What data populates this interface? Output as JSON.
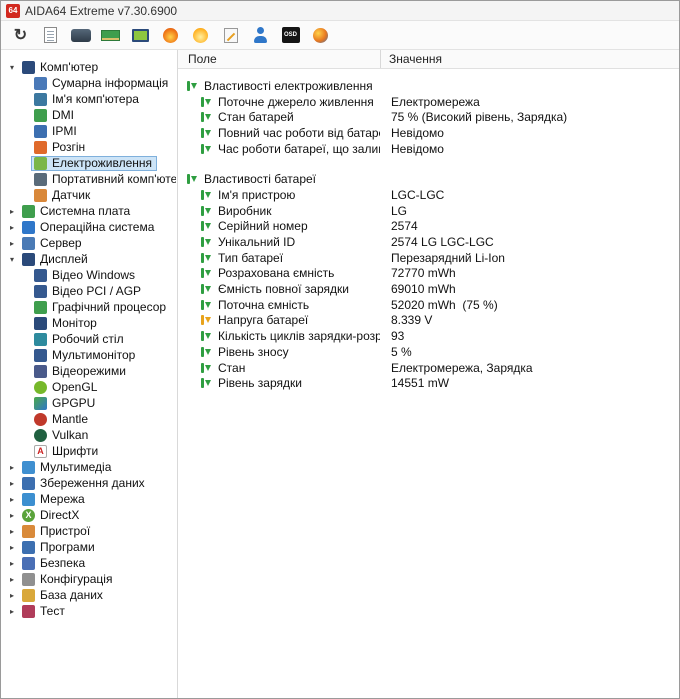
{
  "window": {
    "title": "AIDA64 Extreme v7.30.6900",
    "logo_text": "64"
  },
  "toolbar": {
    "buttons": [
      {
        "icon": "refresh-icon"
      },
      {
        "icon": "report-icon"
      },
      {
        "icon": "display-card-icon"
      },
      {
        "icon": "memory-icon"
      },
      {
        "icon": "monitor-test-icon"
      },
      {
        "icon": "burn-in-icon"
      },
      {
        "icon": "flame-icon"
      },
      {
        "icon": "notes-icon"
      },
      {
        "icon": "audit-icon"
      },
      {
        "icon": "osd-icon",
        "label": "OSD"
      },
      {
        "icon": "sensor-panel-icon"
      }
    ]
  },
  "sidebar": {
    "items": [
      {
        "label": "Комп'ютер",
        "level": 0,
        "icon": "computer",
        "expanded": true
      },
      {
        "label": "Сумарна інформація",
        "level": 1,
        "icon": "summary"
      },
      {
        "label": "Ім'я комп'ютера",
        "level": 1,
        "icon": "computer-name"
      },
      {
        "label": "DMI",
        "level": 1,
        "icon": "dmi"
      },
      {
        "label": "IPMI",
        "level": 1,
        "icon": "ipmi"
      },
      {
        "label": "Розгін",
        "level": 1,
        "icon": "overclock"
      },
      {
        "label": "Електроживлення",
        "level": 1,
        "icon": "power",
        "selected": true
      },
      {
        "label": "Портативний комп'ютер",
        "level": 1,
        "icon": "portable"
      },
      {
        "label": "Датчик",
        "level": 1,
        "icon": "sensor"
      },
      {
        "label": "Системна плата",
        "level": 0,
        "icon": "motherboard",
        "expanded": false
      },
      {
        "label": "Операційна система",
        "level": 0,
        "icon": "os",
        "expanded": false
      },
      {
        "label": "Сервер",
        "level": 0,
        "icon": "server",
        "expanded": false
      },
      {
        "label": "Дисплей",
        "level": 0,
        "icon": "display",
        "expanded": true
      },
      {
        "label": "Відео Windows",
        "level": 1,
        "icon": "video-windows"
      },
      {
        "label": "Відео PCI / AGP",
        "level": 1,
        "icon": "video-pci"
      },
      {
        "label": "Графічний процесор",
        "level": 1,
        "icon": "gpu"
      },
      {
        "label": "Монітор",
        "level": 1,
        "icon": "monitor"
      },
      {
        "label": "Робочий стіл",
        "level": 1,
        "icon": "desktop"
      },
      {
        "label": "Мультимонітор",
        "level": 1,
        "icon": "multimonitor"
      },
      {
        "label": "Відеорежими",
        "level": 1,
        "icon": "videomodes"
      },
      {
        "label": "OpenGL",
        "level": 1,
        "icon": "opengl"
      },
      {
        "label": "GPGPU",
        "level": 1,
        "icon": "gpgpu"
      },
      {
        "label": "Mantle",
        "level": 1,
        "icon": "mantle"
      },
      {
        "label": "Vulkan",
        "level": 1,
        "icon": "vulkan"
      },
      {
        "label": "Шрифти",
        "level": 1,
        "icon": "fonts"
      },
      {
        "label": "Мультимедіа",
        "level": 0,
        "icon": "multimedia",
        "expanded": false
      },
      {
        "label": "Збереження даних",
        "level": 0,
        "icon": "storage",
        "expanded": false
      },
      {
        "label": "Мережа",
        "level": 0,
        "icon": "network",
        "expanded": false
      },
      {
        "label": "DirectX",
        "level": 0,
        "icon": "directx",
        "expanded": false
      },
      {
        "label": "Пристрої",
        "level": 0,
        "icon": "devices",
        "expanded": false
      },
      {
        "label": "Програми",
        "level": 0,
        "icon": "programs",
        "expanded": false
      },
      {
        "label": "Безпека",
        "level": 0,
        "icon": "security",
        "expanded": false
      },
      {
        "label": "Конфігурація",
        "level": 0,
        "icon": "config",
        "expanded": false
      },
      {
        "label": "База даних",
        "level": 0,
        "icon": "database",
        "expanded": false
      },
      {
        "label": "Тест",
        "level": 0,
        "icon": "test",
        "expanded": false
      }
    ]
  },
  "main": {
    "columns": {
      "field": "Поле",
      "value": "Значення"
    },
    "sections": [
      {
        "title": "Властивості електроживлення",
        "rows": [
          {
            "field": "Поточне джерело живлення",
            "value": "Електромережа"
          },
          {
            "field": "Стан батарей",
            "value": "75 % (Високий рівень, Зарядка)"
          },
          {
            "field": "Повний час роботи від батареї",
            "value": "Невідомо"
          },
          {
            "field": "Час роботи батареї, що залиш...",
            "value": "Невідомо"
          }
        ]
      },
      {
        "title": "Властивості батареї",
        "rows": [
          {
            "field": "Ім'я пристрою",
            "value": "LGC-LGC"
          },
          {
            "field": "Виробник",
            "value": "LG"
          },
          {
            "field": "Серійний номер",
            "value": "2574"
          },
          {
            "field": "Унікальний ID",
            "value": "2574 LG LGC-LGC"
          },
          {
            "field": "Тип батареї",
            "value": "Перезарядний Li-Ion"
          },
          {
            "field": "Розрахована ємність",
            "value": "72770 mWh"
          },
          {
            "field": "Ємність повної зарядки",
            "value": "69010 mWh"
          },
          {
            "field": "Поточна ємність",
            "value": "52020 mWh  (75 %)"
          },
          {
            "field": "Напруга батареї",
            "value": "8.339 V",
            "icon": "power"
          },
          {
            "field": "Кількість циклів зарядки-розря...",
            "value": "93"
          },
          {
            "field": "Рівень зносу",
            "value": "5 %"
          },
          {
            "field": "Стан",
            "value": "Електромережа, Зарядка"
          },
          {
            "field": "Рівень зарядки",
            "value": "14551 mW"
          }
        ]
      }
    ]
  }
}
